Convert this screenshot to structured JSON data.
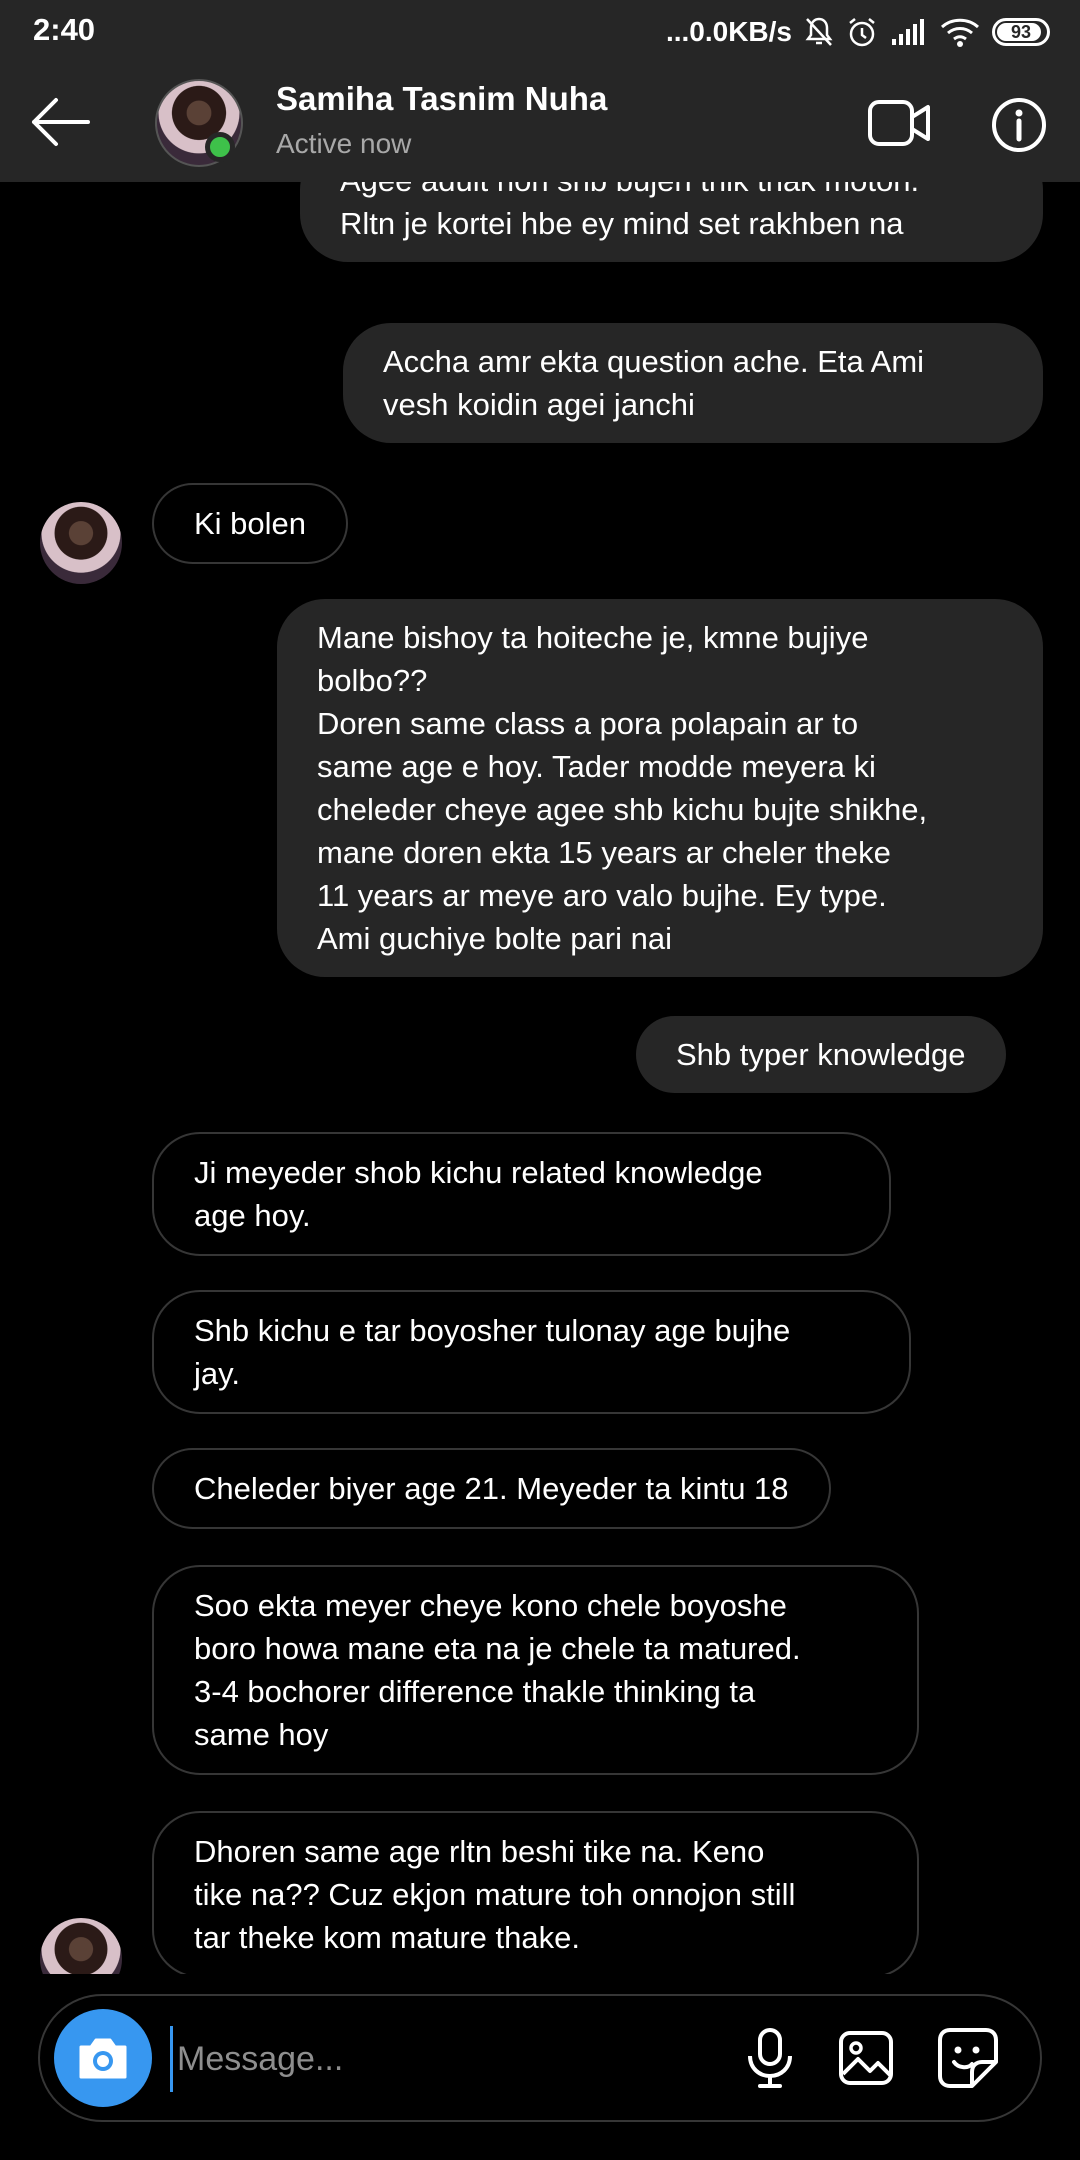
{
  "status_bar": {
    "time": "2:40",
    "network_speed": "...0.0KB/s",
    "battery": "93"
  },
  "header": {
    "contact_name": "Samiha Tasnim Nuha",
    "status": "Active now",
    "online_color": "#3ec14a"
  },
  "messages": [
    {
      "side": "sent",
      "text": "Agee adult hon shb bujen thik thak moton.\nRltn je kortei hbe ey mind set rakhben na"
    },
    {
      "side": "sent",
      "text": "Accha amr ekta question ache. Eta Ami\nvesh koidin agei janchi"
    },
    {
      "side": "received",
      "text": "Ki bolen"
    },
    {
      "side": "sent",
      "text": "Mane bishoy ta hoiteche je, kmne bujiye\nbolbo??\nDoren same class a pora polapain ar to\nsame age e hoy. Tader modde meyera ki\ncheleder cheye agee shb kichu bujte shikhe,\nmane doren ekta 15 years ar cheler theke\n11 years ar meye aro valo bujhe. Ey type.\nAmi guchiye bolte pari nai"
    },
    {
      "side": "sent",
      "text": "Shb typer knowledge"
    },
    {
      "side": "received",
      "text": "Ji meyeder shob kichu related knowledge\nage hoy."
    },
    {
      "side": "received",
      "text": "Shb kichu e tar boyosher tulonay age bujhe\njay."
    },
    {
      "side": "received",
      "text": "Cheleder biyer age 21. Meyeder ta kintu 18"
    },
    {
      "side": "received",
      "text": "Soo ekta meyer cheye kono chele boyoshe\nboro howa mane eta na je chele ta matured.\n3-4 bochorer difference thakle thinking ta\nsame hoy"
    },
    {
      "side": "received",
      "text": "Dhoren same age rltn beshi tike na. Keno\ntike na?? Cuz ekjon mature toh onnojon still\ntar theke kom mature thake."
    }
  ],
  "composer": {
    "placeholder": "Message...",
    "accent": "#3797f0"
  },
  "icons": {
    "back": "arrow-left-icon",
    "video": "video-call-icon",
    "info": "info-icon",
    "camera": "camera-icon",
    "mic": "microphone-icon",
    "gallery": "gallery-icon",
    "sticker": "sticker-icon"
  }
}
